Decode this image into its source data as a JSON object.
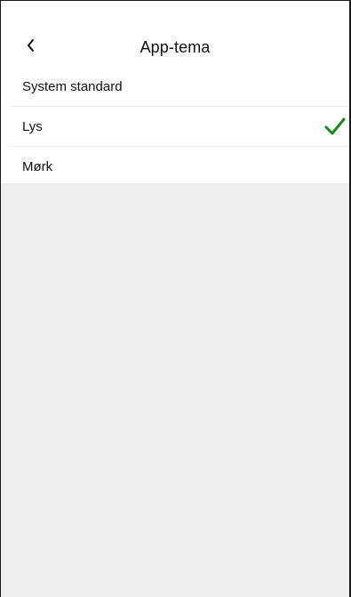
{
  "header": {
    "title": "App-tema",
    "back_icon": "chevron-left-icon"
  },
  "options": [
    {
      "label": "System standard",
      "selected": false
    },
    {
      "label": "Lys",
      "selected": true
    },
    {
      "label": "Mørk",
      "selected": false
    }
  ],
  "colors": {
    "check": "#1b8a1b",
    "background": "#eeeeee",
    "surface": "#ffffff"
  },
  "selected_icon": "checkmark-icon"
}
